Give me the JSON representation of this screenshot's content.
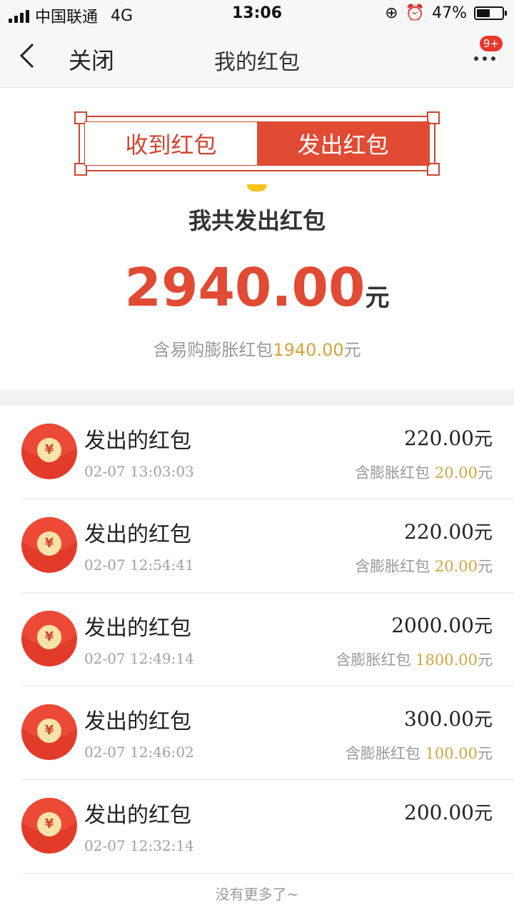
{
  "status_bar": {
    "carrier": "中国联通",
    "network": "4G",
    "time": "13:06",
    "battery": "47%"
  },
  "nav": {
    "back_icon": "chevron-left-icon",
    "close_label": "关闭",
    "title": "我的红包",
    "more_icon": "more-dots-icon",
    "badge": "9+"
  },
  "tabs": [
    {
      "label": "收到红包",
      "active": false
    },
    {
      "label": "发出红包",
      "active": true
    }
  ],
  "summary": {
    "label": "我共发出红包",
    "amount": "2940.00",
    "unit": "元",
    "note_prefix": "含易购膨胀红包",
    "note_value": "1940.00",
    "note_unit": "元"
  },
  "items": [
    {
      "title": "发出的红包",
      "time": "02-07 13:03:03",
      "amount": "220.00",
      "unit": "元",
      "sub_prefix": "含膨胀红包 ",
      "sub_value": "20.00",
      "sub_unit": "元"
    },
    {
      "title": "发出的红包",
      "time": "02-07 12:54:41",
      "amount": "220.00",
      "unit": "元",
      "sub_prefix": "含膨胀红包 ",
      "sub_value": "20.00",
      "sub_unit": "元"
    },
    {
      "title": "发出的红包",
      "time": "02-07 12:49:14",
      "amount": "2000.00",
      "unit": "元",
      "sub_prefix": "含膨胀红包 ",
      "sub_value": "1800.00",
      "sub_unit": "元"
    },
    {
      "title": "发出的红包",
      "time": "02-07 12:46:02",
      "amount": "300.00",
      "unit": "元",
      "sub_prefix": "含膨胀红包 ",
      "sub_value": "100.00",
      "sub_unit": "元"
    },
    {
      "title": "发出的红包",
      "time": "02-07 12:32:14",
      "amount": "200.00",
      "unit": "元",
      "sub_prefix": "",
      "sub_value": "",
      "sub_unit": ""
    }
  ],
  "coin_symbol": "¥",
  "footer": "没有更多了~",
  "colors": {
    "accent": "#e14a33",
    "highlight": "#d6a33a"
  }
}
